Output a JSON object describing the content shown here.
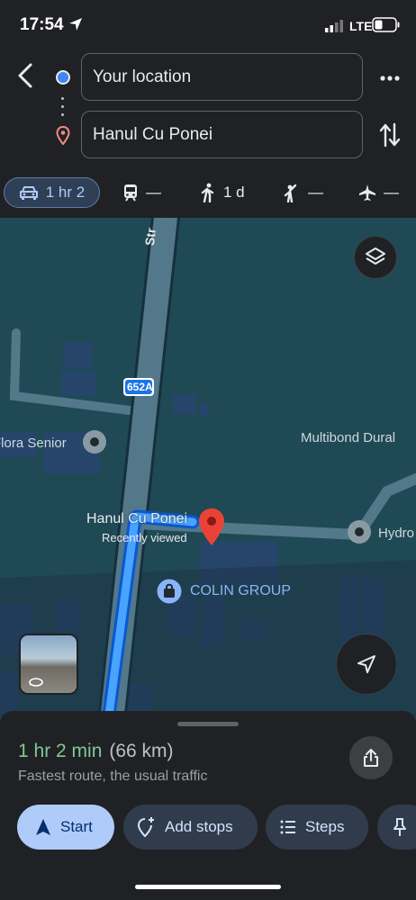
{
  "status": {
    "time": "17:54",
    "network": "LTE"
  },
  "route_inputs": {
    "origin_value": "Your location",
    "destination_value": "Hanul Cu Ponei"
  },
  "modes": [
    {
      "id": "drive",
      "label": "1 hr 2"
    },
    {
      "id": "transit",
      "label": "—"
    },
    {
      "id": "walk",
      "label": "1 d"
    },
    {
      "id": "ride",
      "label": "—"
    },
    {
      "id": "fly",
      "label": "—"
    }
  ],
  "map": {
    "road_shield": "652A",
    "street_partial": "Str",
    "labels": {
      "senior": "Flora Senior",
      "multibond": "Multibond Dural",
      "hydro": "Hydro",
      "place_name": "Hanul Cu Ponei",
      "place_sub": "Recently viewed",
      "colin": "COLIN GROUP"
    },
    "colors": {
      "route": "#1a73e8",
      "pin": "#ea4335",
      "road": "#4f7a8a"
    }
  },
  "sheet": {
    "duration": "1 hr 2 min",
    "distance": "(66 km)",
    "subtitle": "Fastest route, the usual traffic",
    "buttons": {
      "start": "Start",
      "add_stops": "Add stops",
      "steps": "Steps"
    }
  }
}
